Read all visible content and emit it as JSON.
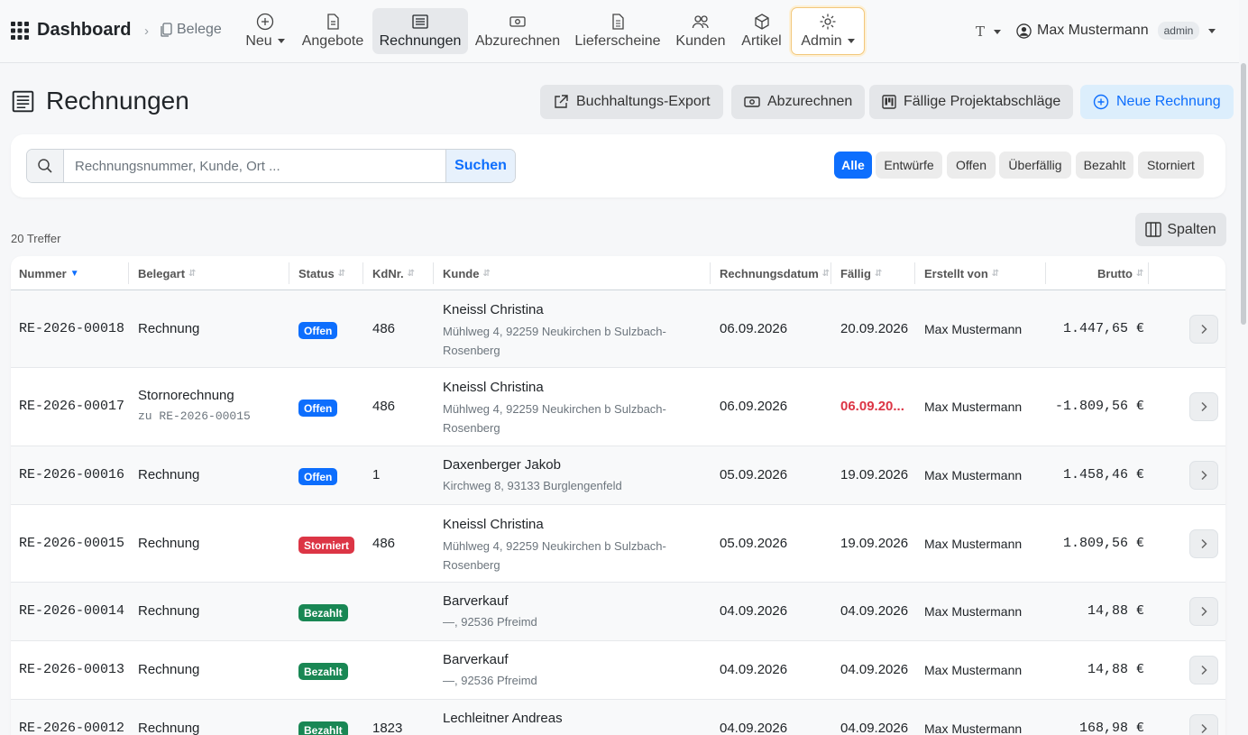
{
  "brand": "Dashboard",
  "breadcrumb": "Belege",
  "nav": {
    "neu": "Neu",
    "angebote": "Angebote",
    "rechnungen": "Rechnungen",
    "abzurechnen": "Abzurechnen",
    "lieferscheine": "Lieferscheine",
    "kunden": "Kunden",
    "artikel": "Artikel",
    "admin": "Admin"
  },
  "lang": "T",
  "user": {
    "name": "Max Mustermann",
    "role": "admin"
  },
  "page": {
    "title": "Rechnungen"
  },
  "actions": {
    "export": "Buchhaltungs-Export",
    "abzurechnen": "Abzurechnen",
    "faellige": "Fällige Projektabschläge",
    "neu": "Neue Rechnung"
  },
  "search": {
    "placeholder": "Rechnungsnummer, Kunde, Ort ...",
    "button": "Suchen"
  },
  "filters": {
    "alle": "Alle",
    "entwuerfe": "Entwürfe",
    "offen": "Offen",
    "ueberfaellig": "Überfällig",
    "bezahlt": "Bezahlt",
    "storniert": "Storniert"
  },
  "count": "20 Treffer",
  "columns_button": "Spalten",
  "table": {
    "headers": {
      "nummer": "Nummer",
      "belegart": "Belegart",
      "status": "Status",
      "kdnr": "KdNr.",
      "kunde": "Kunde",
      "datum": "Rechnungsdatum",
      "faellig": "Fällig",
      "erstellt": "Erstellt von",
      "brutto": "Brutto"
    },
    "rows": [
      {
        "nummer": "RE-2026-00018",
        "belegart": "Rechnung",
        "status": "Offen",
        "kdnr": "486",
        "kunde": "Kneissl Christina",
        "adresse": "Mühlweg 4, 92259 Neukirchen b Sulzbach-Rosenberg",
        "datum": "06.09.2026",
        "faellig": "20.09.2026",
        "erstellt": "Max Mustermann",
        "brutto": "1.447,65 €"
      },
      {
        "nummer": "RE-2026-00017",
        "belegart": "Stornorechnung",
        "belegart_sub": "zu RE-2026-00015",
        "status": "Offen",
        "kdnr": "486",
        "kunde": "Kneissl Christina",
        "adresse": "Mühlweg 4, 92259 Neukirchen b Sulzbach-Rosenberg",
        "datum": "06.09.2026",
        "faellig": "06.09.20...",
        "erstellt": "Max Mustermann",
        "brutto": "-1.809,56 €"
      },
      {
        "nummer": "RE-2026-00016",
        "belegart": "Rechnung",
        "status": "Offen",
        "kdnr": "1",
        "kunde": "Daxenberger Jakob",
        "adresse": "Kirchweg 8, 93133 Burglengenfeld",
        "datum": "05.09.2026",
        "faellig": "19.09.2026",
        "erstellt": "Max Mustermann",
        "brutto": "1.458,46 €"
      },
      {
        "nummer": "RE-2026-00015",
        "belegart": "Rechnung",
        "status": "Storniert",
        "kdnr": "486",
        "kunde": "Kneissl Christina",
        "adresse": "Mühlweg 4, 92259 Neukirchen b Sulzbach-Rosenberg",
        "datum": "05.09.2026",
        "faellig": "19.09.2026",
        "erstellt": "Max Mustermann",
        "brutto": "1.809,56 €"
      },
      {
        "nummer": "RE-2026-00014",
        "belegart": "Rechnung",
        "status": "Bezahlt",
        "kdnr": "",
        "kunde": "Barverkauf",
        "adresse": "—, 92536 Pfreimd",
        "datum": "04.09.2026",
        "faellig": "04.09.2026",
        "erstellt": "Max Mustermann",
        "brutto": "14,88 €"
      },
      {
        "nummer": "RE-2026-00013",
        "belegart": "Rechnung",
        "status": "Bezahlt",
        "kdnr": "",
        "kunde": "Barverkauf",
        "adresse": "—, 92536 Pfreimd",
        "datum": "04.09.2026",
        "faellig": "04.09.2026",
        "erstellt": "Max Mustermann",
        "brutto": "14,88 €"
      },
      {
        "nummer": "RE-2026-00012",
        "belegart": "Rechnung",
        "status": "Bezahlt",
        "kdnr": "1823",
        "kunde": "Lechleitner Andreas",
        "adresse": "",
        "datum": "04.09.2026",
        "faellig": "04.09.2026",
        "erstellt": "Max Mustermann",
        "brutto": "168,98 €"
      }
    ]
  }
}
